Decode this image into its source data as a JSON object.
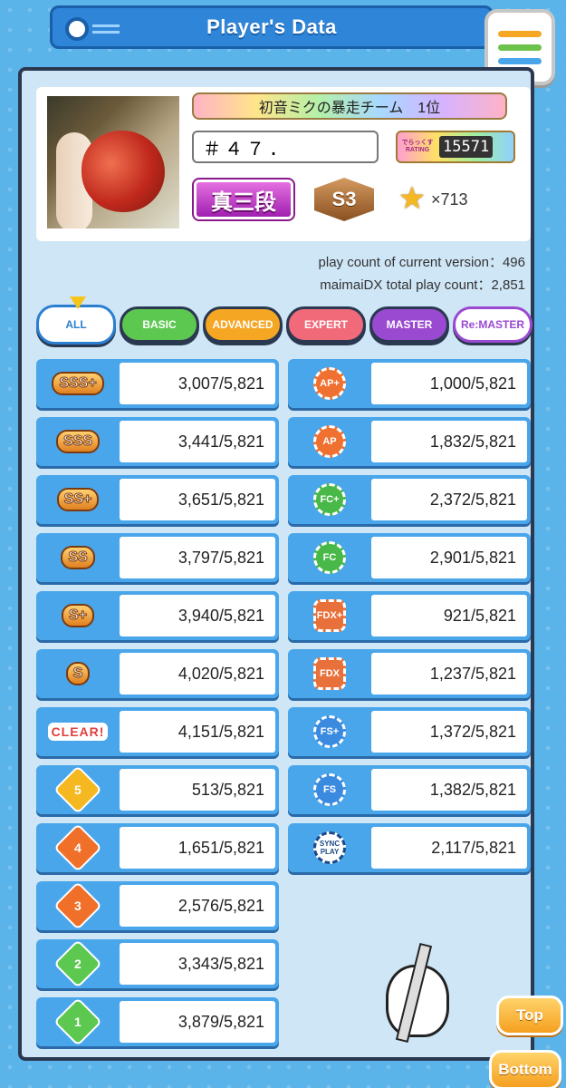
{
  "header": {
    "title": "Player's Data"
  },
  "menu": {
    "bar_colors": [
      "#f5a623",
      "#6cc24a",
      "#4aa6ea"
    ]
  },
  "profile": {
    "title_plate": "初音ミクの暴走チーム　1位",
    "player_name": "＃４７.",
    "rating_label": "でらっくす RATING",
    "rating_value": "15571",
    "dan": "真三段",
    "class": "S3",
    "stars": "×713"
  },
  "play_counts": {
    "current_version": "play count of current version：496",
    "total": "maimaiDX total play count：2,851"
  },
  "tabs": [
    {
      "label": "ALL",
      "color": "#ffffff"
    },
    {
      "label": "BASIC",
      "color": "#5cc850"
    },
    {
      "label": "ADVANCED",
      "color": "#f5a623"
    },
    {
      "label": "EXPERT",
      "color": "#f06a7a"
    },
    {
      "label": "MASTER",
      "color": "#9a4ad0"
    },
    {
      "label": "Re:MASTER",
      "color": "#e9d4f7"
    }
  ],
  "left_stats": [
    {
      "icon": "SSS+",
      "value": "3,007/5,821"
    },
    {
      "icon": "SSS",
      "value": "3,441/5,821"
    },
    {
      "icon": "SS+",
      "value": "3,651/5,821"
    },
    {
      "icon": "SS",
      "value": "3,797/5,821"
    },
    {
      "icon": "S+",
      "value": "3,940/5,821"
    },
    {
      "icon": "S",
      "value": "4,020/5,821"
    },
    {
      "icon": "CLEAR!",
      "value": "4,151/5,821"
    },
    {
      "icon": "5",
      "value": "513/5,821"
    },
    {
      "icon": "4",
      "value": "1,651/5,821"
    },
    {
      "icon": "3",
      "value": "2,576/5,821"
    },
    {
      "icon": "2",
      "value": "3,343/5,821"
    },
    {
      "icon": "1",
      "value": "3,879/5,821"
    }
  ],
  "right_stats": [
    {
      "icon": "AP+",
      "value": "1,000/5,821"
    },
    {
      "icon": "AP",
      "value": "1,832/5,821"
    },
    {
      "icon": "FC+",
      "value": "2,372/5,821"
    },
    {
      "icon": "FC",
      "value": "2,901/5,821"
    },
    {
      "icon": "FDX+",
      "value": "921/5,821"
    },
    {
      "icon": "FDX",
      "value": "1,237/5,821"
    },
    {
      "icon": "FS+",
      "value": "1,372/5,821"
    },
    {
      "icon": "FS",
      "value": "1,382/5,821"
    },
    {
      "icon": "SYNC PLAY",
      "value": "2,117/5,821"
    }
  ],
  "buttons": {
    "top": "Top",
    "bottom": "Bottom"
  }
}
